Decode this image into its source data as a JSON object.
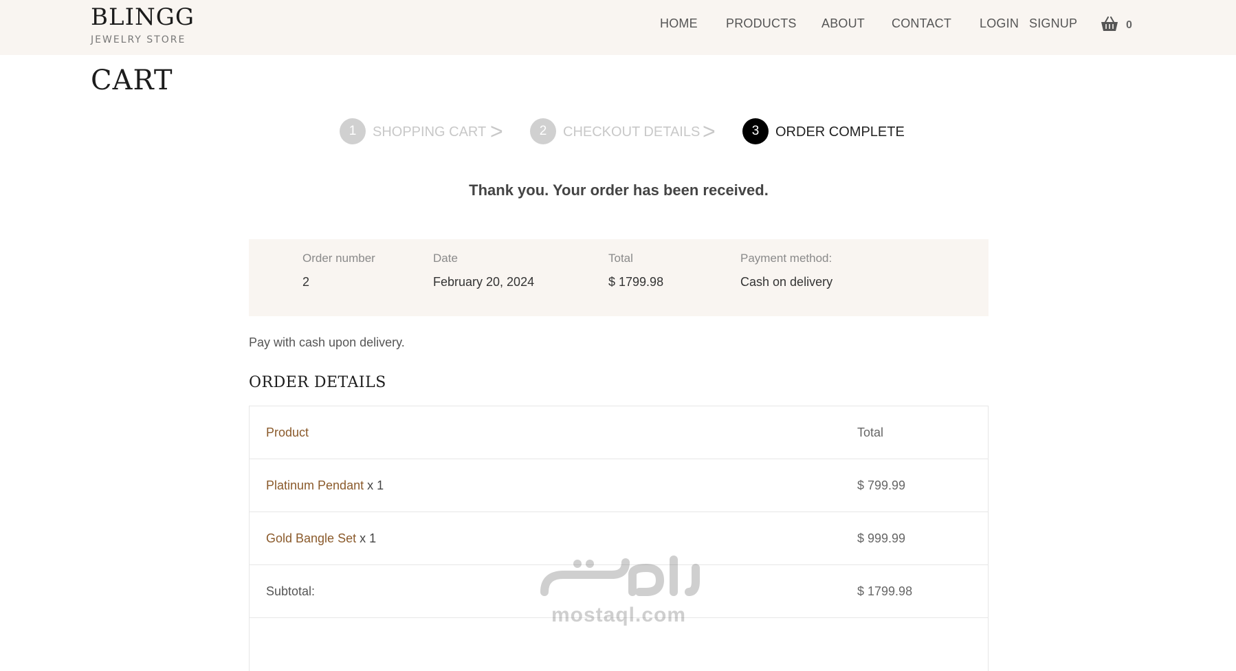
{
  "header": {
    "logo_title": "BLINGG",
    "logo_subtitle": "JEWELRY STORE",
    "nav": {
      "home": "HOME",
      "products": "PRODUCTS",
      "about": "ABOUT",
      "contact": "CONTACT",
      "login": "LOGIN",
      "signup": "SIGNUP"
    },
    "cart_icon": "basket-icon",
    "cart_count": "0"
  },
  "page_title": "CART",
  "steps": [
    {
      "number": "1",
      "label": "SHOPPING CART",
      "active": false
    },
    {
      "number": "2",
      "label": "CHECKOUT DETAILS",
      "active": false
    },
    {
      "number": "3",
      "label": "ORDER COMPLETE",
      "active": true
    }
  ],
  "step_separator": ">",
  "thank_you": "Thank you. Your order has been received.",
  "summary": {
    "order_number_label": "Order number",
    "order_number": "2",
    "date_label": "Date",
    "date": "February 20, 2024",
    "total_label": "Total",
    "total": "$ 1799.98",
    "payment_label": "Payment method:",
    "payment": "Cash on delivery"
  },
  "pay_note": "Pay with cash upon delivery.",
  "order_details_title": "ORDER DETAILS",
  "table": {
    "head_product": "Product",
    "head_total": "Total",
    "items": [
      {
        "name": "Platinum Pendant",
        "qty": "x 1",
        "total": "$ 799.99"
      },
      {
        "name": "Gold Bangle Set",
        "qty": "x 1",
        "total": "$ 999.99"
      }
    ],
    "subtotal_label": "Subtotal:",
    "subtotal": "$ 1799.98"
  },
  "watermark": "mostaql.com",
  "colors": {
    "header_bg": "#f9f5f1",
    "accent_brown": "#8a5a2b",
    "active_step": "#000000",
    "inactive_step": "#d0d0d0"
  }
}
